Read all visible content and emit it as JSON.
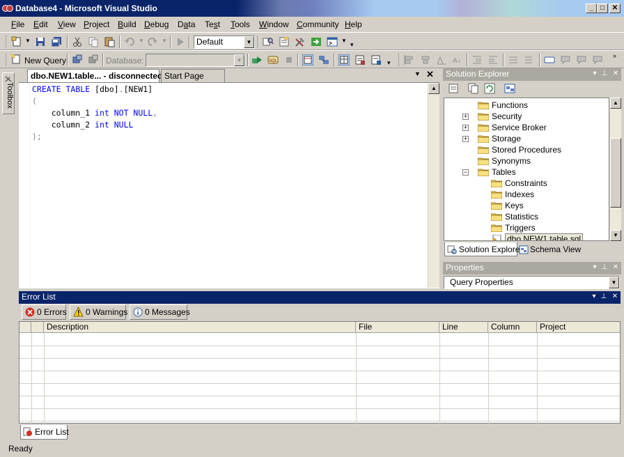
{
  "window": {
    "title": "Database4 - Microsoft Visual Studio",
    "minimize": "_",
    "maximize": "□",
    "close": "✕"
  },
  "menu": [
    {
      "pre": "",
      "u": "F",
      "post": "ile"
    },
    {
      "pre": "",
      "u": "E",
      "post": "dit"
    },
    {
      "pre": "",
      "u": "V",
      "post": "iew"
    },
    {
      "pre": "",
      "u": "P",
      "post": "roject"
    },
    {
      "pre": "",
      "u": "B",
      "post": "uild"
    },
    {
      "pre": "",
      "u": "D",
      "post": "ebug"
    },
    {
      "pre": "D",
      "u": "a",
      "post": "ta"
    },
    {
      "pre": "Te",
      "u": "s",
      "post": "t"
    },
    {
      "pre": "",
      "u": "T",
      "post": "ools"
    },
    {
      "pre": "",
      "u": "W",
      "post": "indow"
    },
    {
      "pre": "",
      "u": "C",
      "post": "ommunity"
    },
    {
      "pre": "",
      "u": "H",
      "post": "elp"
    }
  ],
  "toolbar": {
    "config_combo": "Default",
    "new_query_label": "New Query",
    "database_label": "Database:",
    "database_value": ""
  },
  "toolbox": {
    "label": "Toolbox"
  },
  "editor": {
    "tabs": [
      {
        "label": "dbo.NEW1.table... - disconnected",
        "active": true
      },
      {
        "label": "Start Page",
        "active": false
      }
    ],
    "lines": [
      [
        {
          "t": "CREATE",
          "c": "kw"
        },
        {
          "t": " ",
          "c": "plain"
        },
        {
          "t": "TABLE",
          "c": "kw"
        },
        {
          "t": " [dbo]",
          "c": "plain"
        },
        {
          "t": ".",
          "c": "op"
        },
        {
          "t": "[NEW1]",
          "c": "plain"
        }
      ],
      [
        {
          "t": "(",
          "c": "op"
        }
      ],
      [
        {
          "t": "    column_1 ",
          "c": "plain"
        },
        {
          "t": "int",
          "c": "kw"
        },
        {
          "t": " ",
          "c": "plain"
        },
        {
          "t": "NOT NULL",
          "c": "kw"
        },
        {
          "t": ",",
          "c": "op"
        }
      ],
      [
        {
          "t": "    column_2 ",
          "c": "plain"
        },
        {
          "t": "int",
          "c": "kw"
        },
        {
          "t": " ",
          "c": "plain"
        },
        {
          "t": "NULL",
          "c": "kw"
        }
      ],
      [
        {
          "t": ");",
          "c": "op"
        }
      ]
    ]
  },
  "solution_explorer": {
    "title": "Solution Explorer",
    "items": [
      {
        "label": "Functions",
        "indent": 0,
        "expander": ""
      },
      {
        "label": "Security",
        "indent": 0,
        "expander": "+"
      },
      {
        "label": "Service Broker",
        "indent": 0,
        "expander": "+"
      },
      {
        "label": "Storage",
        "indent": 0,
        "expander": "+"
      },
      {
        "label": "Stored Procedures",
        "indent": 0,
        "expander": ""
      },
      {
        "label": "Synonyms",
        "indent": 0,
        "expander": ""
      },
      {
        "label": "Tables",
        "indent": 0,
        "expander": "−"
      },
      {
        "label": "Constraints",
        "indent": 1,
        "expander": ""
      },
      {
        "label": "Indexes",
        "indent": 1,
        "expander": ""
      },
      {
        "label": "Keys",
        "indent": 1,
        "expander": ""
      },
      {
        "label": "Statistics",
        "indent": 1,
        "expander": ""
      },
      {
        "label": "Triggers",
        "indent": 1,
        "expander": ""
      },
      {
        "label": "dbo.NEW1.table.sql",
        "indent": 1,
        "expander": "",
        "file": true
      }
    ],
    "tabs": [
      "Solution Explorer",
      "Schema View"
    ]
  },
  "properties": {
    "title": "Properties",
    "object": "Query Properties"
  },
  "error_list": {
    "title": "Error List",
    "filters": [
      "0 Errors",
      "0 Warnings",
      "0 Messages"
    ],
    "columns": [
      "",
      "",
      "Description",
      "File",
      "Line",
      "Column",
      "Project"
    ],
    "tab_label": "Error List"
  },
  "status": {
    "text": "Ready"
  },
  "colors": {
    "active_title": "#0a246a",
    "chrome": "#d4d0c8",
    "keyword": "#0000ff"
  }
}
